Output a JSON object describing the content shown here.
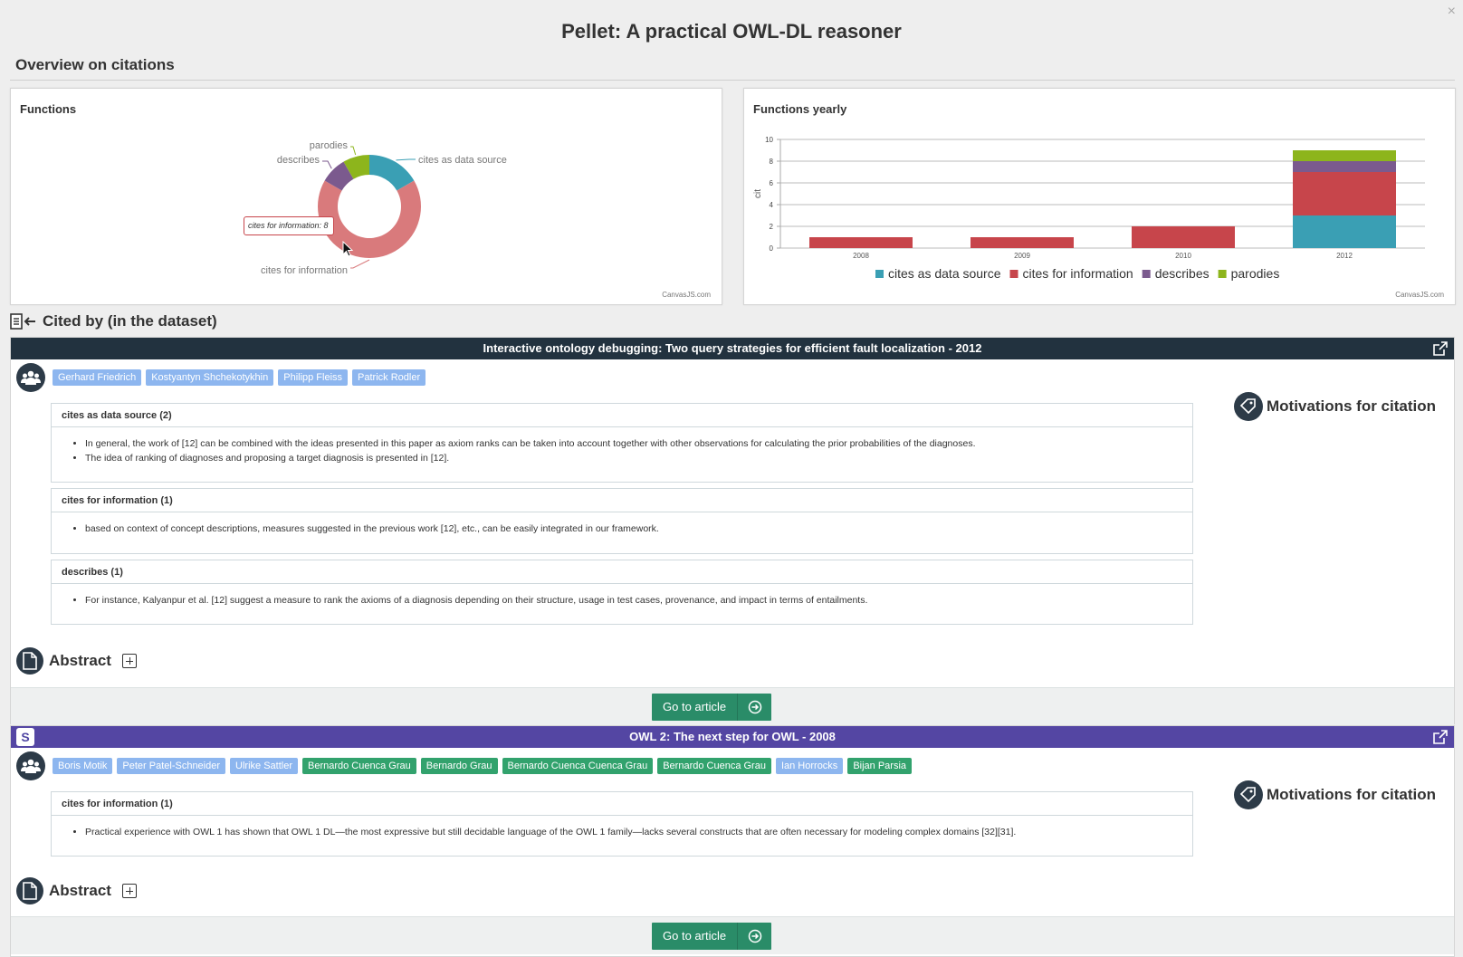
{
  "window": {
    "close": "×"
  },
  "page": {
    "title": "Pellet: A practical OWL-DL reasoner",
    "section": "Overview on citations"
  },
  "functions_panel": {
    "title": "Functions",
    "credit": "CanvasJS.com",
    "tooltip": "cites for information: 8"
  },
  "yearly_panel": {
    "title": "Functions yearly",
    "credit": "CanvasJS.com"
  },
  "colors": {
    "data_source": "#3a9fb4",
    "information": "#c7454b",
    "information_pie": "#d97a7c",
    "describes": "#7b5a8e",
    "parodies": "#8db51c",
    "dark_bar": "#22323f",
    "purple_bar": "#5446a3"
  },
  "chart_data": [
    {
      "type": "pie",
      "title": "Functions",
      "labels": [
        "cites as data source",
        "cites for information",
        "describes",
        "parodies"
      ],
      "values": [
        2,
        8,
        1,
        1
      ]
    },
    {
      "type": "bar",
      "title": "Functions yearly",
      "categories": [
        "2008",
        "2009",
        "2010",
        "2012"
      ],
      "ylabel": "cit",
      "ylim": [
        0,
        10
      ],
      "yticks": [
        "0",
        "2",
        "4",
        "6",
        "8",
        "10"
      ],
      "stacked": true,
      "legend_position": "bottom",
      "series": [
        {
          "name": "cites as data source",
          "values": [
            0,
            0,
            0,
            3
          ]
        },
        {
          "name": "cites for information",
          "values": [
            1,
            1,
            2,
            4
          ]
        },
        {
          "name": "describes",
          "values": [
            0,
            0,
            0,
            1
          ]
        },
        {
          "name": "parodies",
          "values": [
            0,
            0,
            0,
            1
          ]
        }
      ]
    }
  ],
  "cited_by": {
    "heading": "Cited by (in the dataset)",
    "motivations_label": "Motivations for citation",
    "abstract_label": "Abstract",
    "go_label": "Go to article",
    "articles": [
      {
        "title": "Interactive ontology debugging: Two query strategies for efficient fault localization - 2012",
        "authors": [
          "Gerhard Friedrich",
          "Kostyantyn Shchekotykhin",
          "Philipp Fleiss",
          "Patrick Rodler"
        ],
        "functions": [
          {
            "name": "cites as data source (2)",
            "items": [
              "In general, the work of [12] can be combined with the ideas presented in this paper as axiom ranks can be taken into account together with other observations for calculating the prior probabilities of the diagnoses.",
              "The idea of ranking of diagnoses and proposing a target diagnosis is presented in [12]."
            ]
          },
          {
            "name": "cites for information (1)",
            "items": [
              "based on context of concept descriptions, measures suggested in the previous work [12], etc., can be easily integrated in our framework."
            ]
          },
          {
            "name": "describes (1)",
            "items": [
              "For instance, Kalyanpur et al. [12] suggest a measure to rank the axioms of a diagnosis depending on their structure, usage in test cases, provenance, and impact in terms of entailments."
            ]
          }
        ]
      },
      {
        "badge": "S",
        "title": "OWL 2: The next step for OWL - 2008",
        "authors": [
          "Boris Motik",
          "Peter Patel-Schneider",
          "Ulrike Sattler",
          "Bernardo Cuenca Grau",
          "Bernardo Grau",
          "Bernardo Cuenca Cuenca Grau",
          "Bernardo Cuenca Grau",
          "Ian Horrocks",
          "Bijan Parsia"
        ],
        "functions": [
          {
            "name": "cites for information (1)",
            "items": [
              "Practical experience with OWL 1 has shown that OWL 1 DL—the most expressive but still decidable language of the OWL 1 family—lacks several constructs that are often necessary for modeling complex domains [32][31]."
            ]
          }
        ]
      }
    ]
  }
}
